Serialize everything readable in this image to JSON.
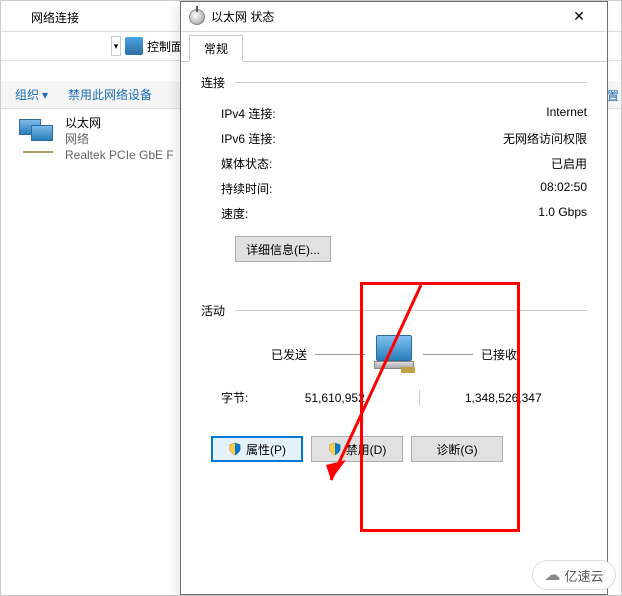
{
  "bg": {
    "title": "网络连接",
    "breadcrumb": "控制面",
    "toolbar": {
      "organize": "组织",
      "disable": "禁用此网络设备",
      "right": "设置"
    },
    "adapter": {
      "name": "以太网",
      "network": "网络",
      "device": "Realtek PCIe GbE F"
    }
  },
  "dlg": {
    "title": "以太网 状态",
    "tab": "常规",
    "conn_header": "连接",
    "rows": {
      "ipv4": {
        "k": "IPv4 连接:",
        "v": "Internet"
      },
      "ipv6": {
        "k": "IPv6 连接:",
        "v": "无网络访问权限"
      },
      "media": {
        "k": "媒体状态:",
        "v": "已启用"
      },
      "duration": {
        "k": "持续时间:",
        "v": "08:02:50"
      },
      "speed": {
        "k": "速度:",
        "v": "1.0 Gbps"
      }
    },
    "details_btn": "详细信息(E)...",
    "activity_header": "活动",
    "sent_label": "已发送",
    "recv_label": "已接收",
    "bytes_label": "字节:",
    "bytes_sent": "51,610,952",
    "bytes_recv": "1,348,526,347",
    "btn_props": "属性(P)",
    "btn_disable": "禁用(D)",
    "btn_diag": "诊断(G)"
  },
  "brand": "亿速云"
}
